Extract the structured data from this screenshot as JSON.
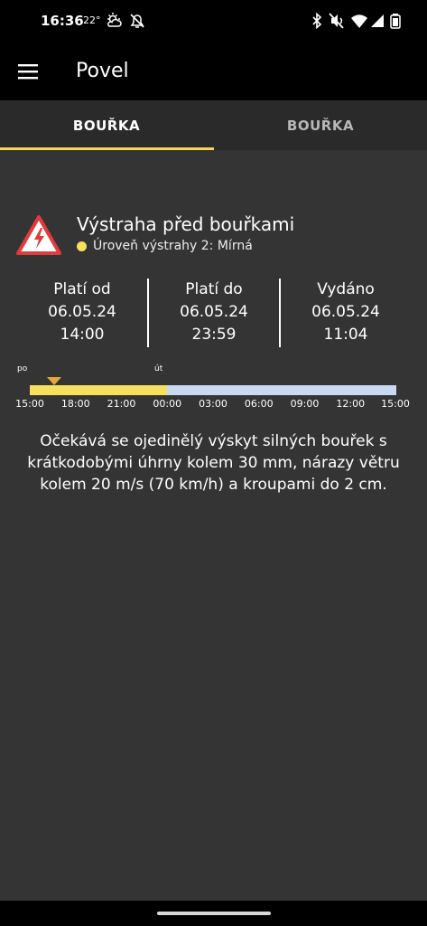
{
  "status_bar": {
    "time": "16:36",
    "temperature": "22°",
    "icons": [
      "weather-sunny-cloud-icon",
      "alarm-off-icon",
      "bluetooth-icon",
      "mute-icon",
      "wifi-icon",
      "signal-icon",
      "battery-icon"
    ]
  },
  "app_bar": {
    "title": "Povel",
    "menu_icon": "hamburger-menu-icon"
  },
  "tabs": [
    {
      "label": "BOUŘKA",
      "active": true
    },
    {
      "label": "BOUŘKA",
      "active": false
    }
  ],
  "warning": {
    "title": "Výstraha před bouřkami",
    "level_label": "Úroveň výstrahy 2: Mírná",
    "level_color": "#f6e05e",
    "icon": "storm-warning-triangle-icon",
    "icon_color": "#e23b3b"
  },
  "validity": [
    {
      "label": "Platí od",
      "date": "06.05.24",
      "time": "14:00"
    },
    {
      "label": "Platí do",
      "date": "06.05.24",
      "time": "23:59"
    },
    {
      "label": "Vydáno",
      "date": "06.05.24",
      "time": "11:04"
    }
  ],
  "timeline": {
    "day_labels": [
      "po",
      "út"
    ],
    "ticks": [
      "15:00",
      "18:00",
      "21:00",
      "00:00",
      "03:00",
      "06:00",
      "09:00",
      "12:00",
      "15:00"
    ],
    "warning_fill_fraction": 0.375,
    "current_time_fraction": 0.0667,
    "fill_color": "#f6e05e",
    "background_color": "#c9d8f3",
    "marker_color": "#e4a83c"
  },
  "description": "Očekává se ojedinělý výskyt silných bouřek s krátkodobými úhrny kolem 30 mm, nárazy větru kolem 20 m/s (70 km/h) a kroupami do 2 cm."
}
